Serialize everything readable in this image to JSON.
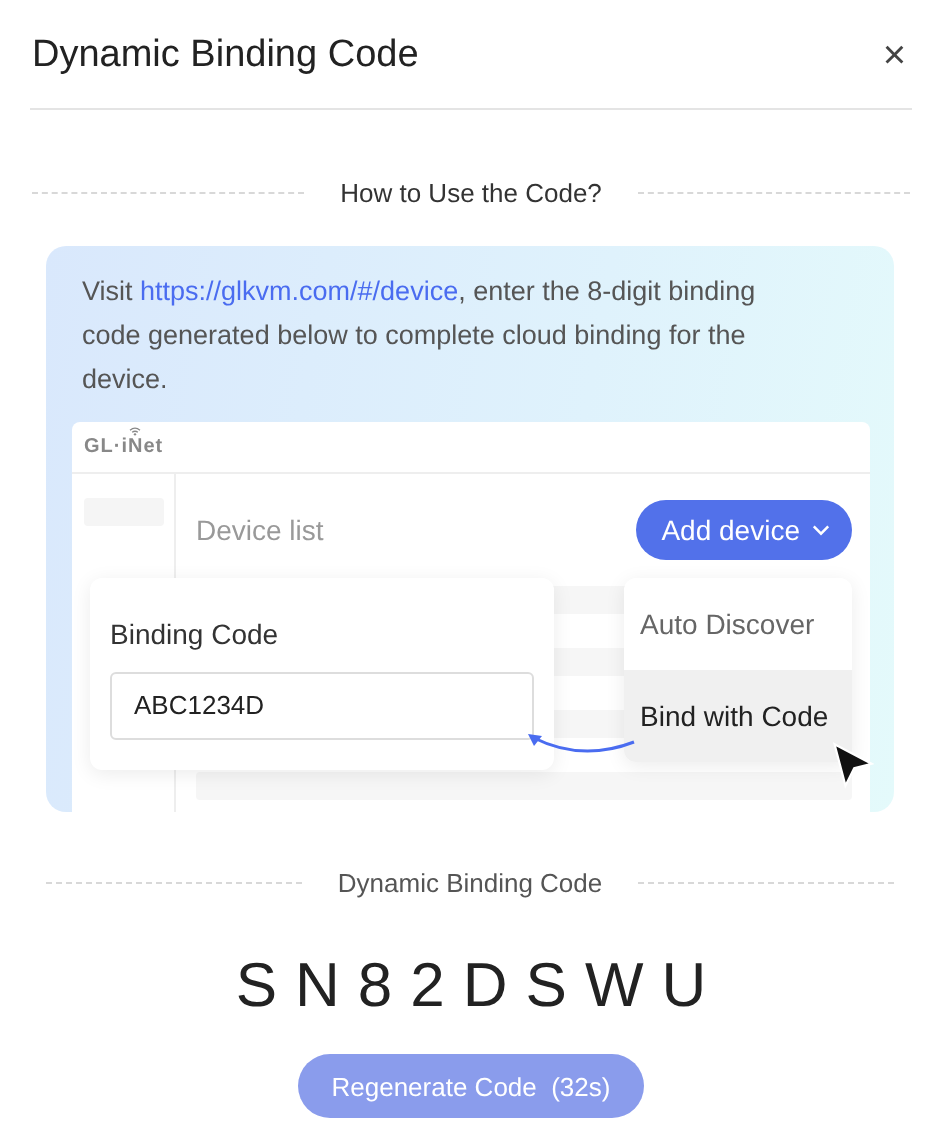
{
  "dialog": {
    "title": "Dynamic Binding Code",
    "close": "×"
  },
  "how_to": {
    "heading": "How to Use the Code?",
    "instruction_before": "Visit ",
    "link": "https://glkvm.com/#/device",
    "instruction_after": ", enter the 8-digit binding code generated below to complete cloud binding for the device.",
    "mockup": {
      "logo": "GL·iNet",
      "page_title": "Device list",
      "add_button": "Add device",
      "field_label": "Binding Code",
      "field_value": "ABC1234D",
      "menu_items": [
        {
          "label": "Auto Discover",
          "selected": false
        },
        {
          "label": "Bind with Code",
          "selected": true
        }
      ]
    }
  },
  "code_section": {
    "heading": "Dynamic Binding Code",
    "code": "SN82DSWU",
    "regenerate_button": {
      "label": "Regenerate Code  (32s)",
      "disabled": true
    }
  }
}
